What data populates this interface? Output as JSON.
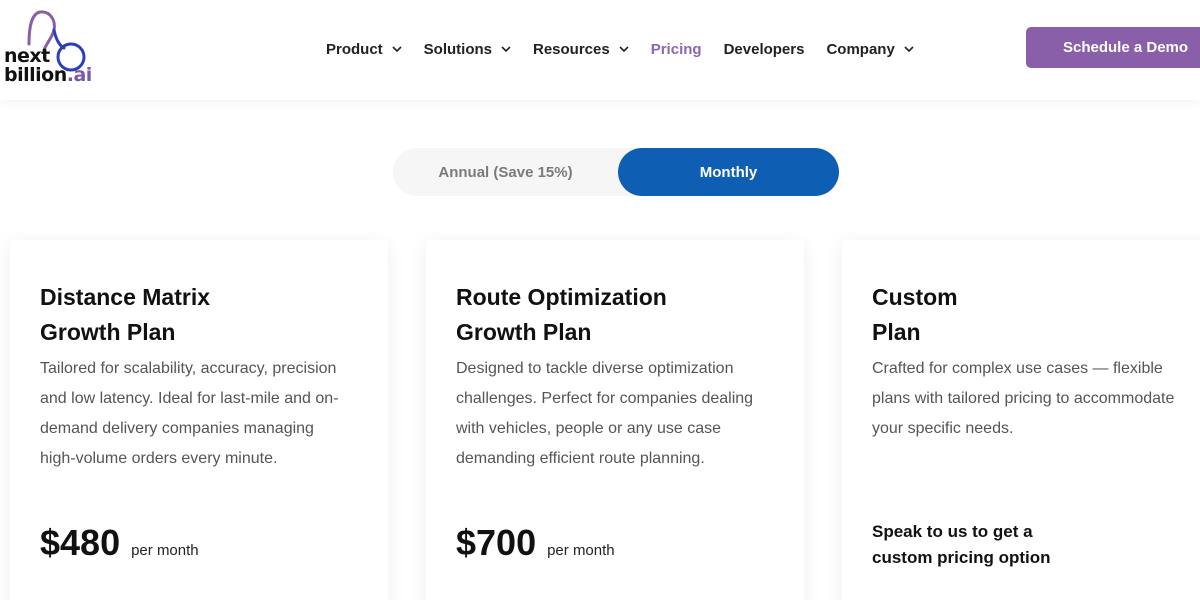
{
  "brand": {
    "logo_line1": "next",
    "logo_line2_a": "billion",
    "logo_line2_b": ".ai"
  },
  "nav": [
    {
      "label": "Product",
      "has_dropdown": true
    },
    {
      "label": "Solutions",
      "has_dropdown": true
    },
    {
      "label": "Resources",
      "has_dropdown": true
    },
    {
      "label": "Pricing",
      "has_dropdown": false,
      "active": true
    },
    {
      "label": "Developers",
      "has_dropdown": false
    },
    {
      "label": "Company",
      "has_dropdown": true
    }
  ],
  "header": {
    "cta_label": "Schedule a Demo"
  },
  "billing_toggle": {
    "annual_label": "Annual (Save 15%)",
    "monthly_label": "Monthly",
    "selected": "Monthly"
  },
  "plans": [
    {
      "title_line1": "Distance Matrix",
      "title_line2": "Growth Plan",
      "description": "Tailored for scalability, accuracy, precision and low latency. Ideal for last-mile and on-demand delivery companies managing high-volume orders every minute.",
      "price": "$480",
      "period": "per month"
    },
    {
      "title_line1": "Route Optimization",
      "title_line2": "Growth Plan",
      "description": "Designed to tackle diverse optimization challenges. Perfect for companies dealing with vehicles, people or any use case demanding efficient route planning.",
      "price": "$700",
      "period": "per month"
    },
    {
      "title_line1": "Custom",
      "title_line2": "Plan",
      "description": "Crafted for complex use cases — flexible plans with tailored pricing to accommodate your specific needs.",
      "cta_line1": "Speak to us to get a",
      "cta_line2": "custom pricing option"
    }
  ],
  "colors": {
    "brand_purple": "#8a5fa9",
    "active_nav": "#8a67b3",
    "toggle_blue": "#0e5eb3"
  }
}
